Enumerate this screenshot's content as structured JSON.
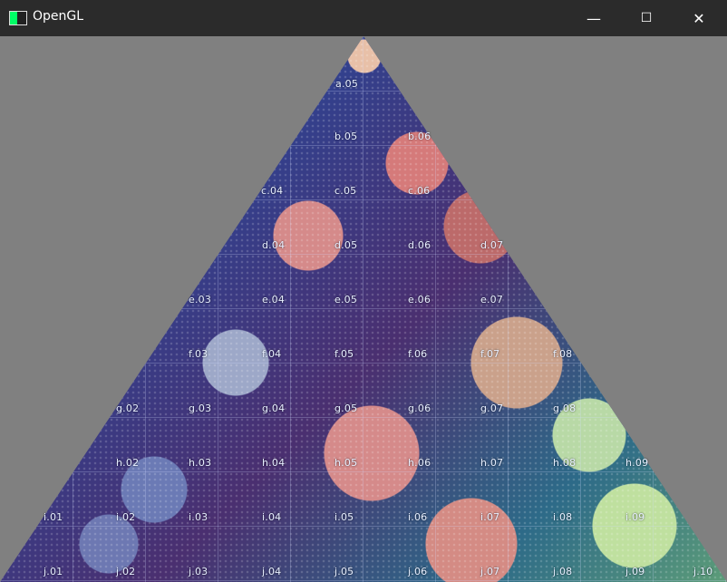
{
  "window": {
    "title": "OpenGL",
    "controls": {
      "minimize_icon": "—",
      "maximize_icon": "☐",
      "close_icon": "✕"
    }
  },
  "scene": {
    "background_color": "#808080",
    "grid_labels": [
      {
        "text": "a.05"
      },
      {
        "text": "b.05"
      },
      {
        "text": "b.06"
      },
      {
        "text": "c.04"
      },
      {
        "text": "c.05"
      },
      {
        "text": "c.06"
      },
      {
        "text": "d.04"
      },
      {
        "text": "d.05"
      },
      {
        "text": "d.06"
      },
      {
        "text": "d.07"
      },
      {
        "text": "e.03"
      },
      {
        "text": "e.04"
      },
      {
        "text": "e.05"
      },
      {
        "text": "e.06"
      },
      {
        "text": "e.07"
      },
      {
        "text": "f.03"
      },
      {
        "text": "f.04"
      },
      {
        "text": "f.05"
      },
      {
        "text": "f.06"
      },
      {
        "text": "f.07"
      },
      {
        "text": "f.08"
      },
      {
        "text": "g.02"
      },
      {
        "text": "g.03"
      },
      {
        "text": "g.04"
      },
      {
        "text": "g.05"
      },
      {
        "text": "g.06"
      },
      {
        "text": "g.07"
      },
      {
        "text": "g.08"
      },
      {
        "text": "h.02"
      },
      {
        "text": "h.03"
      },
      {
        "text": "h.04"
      },
      {
        "text": "h.05"
      },
      {
        "text": "h.06"
      },
      {
        "text": "h.07"
      },
      {
        "text": "h.08"
      },
      {
        "text": "h.09"
      },
      {
        "text": "i.01"
      },
      {
        "text": "i.02"
      },
      {
        "text": "i.03"
      },
      {
        "text": "i.04"
      },
      {
        "text": "i.05"
      },
      {
        "text": "i.06"
      },
      {
        "text": "i.07"
      },
      {
        "text": "i.08"
      },
      {
        "text": "i.09"
      },
      {
        "text": "j.01"
      },
      {
        "text": "j.02"
      },
      {
        "text": "j.03"
      },
      {
        "text": "j.04"
      },
      {
        "text": "j.05"
      },
      {
        "text": "j.06"
      },
      {
        "text": "j.07"
      },
      {
        "text": "j.08"
      },
      {
        "text": "j.09"
      },
      {
        "text": "j.10"
      }
    ]
  }
}
